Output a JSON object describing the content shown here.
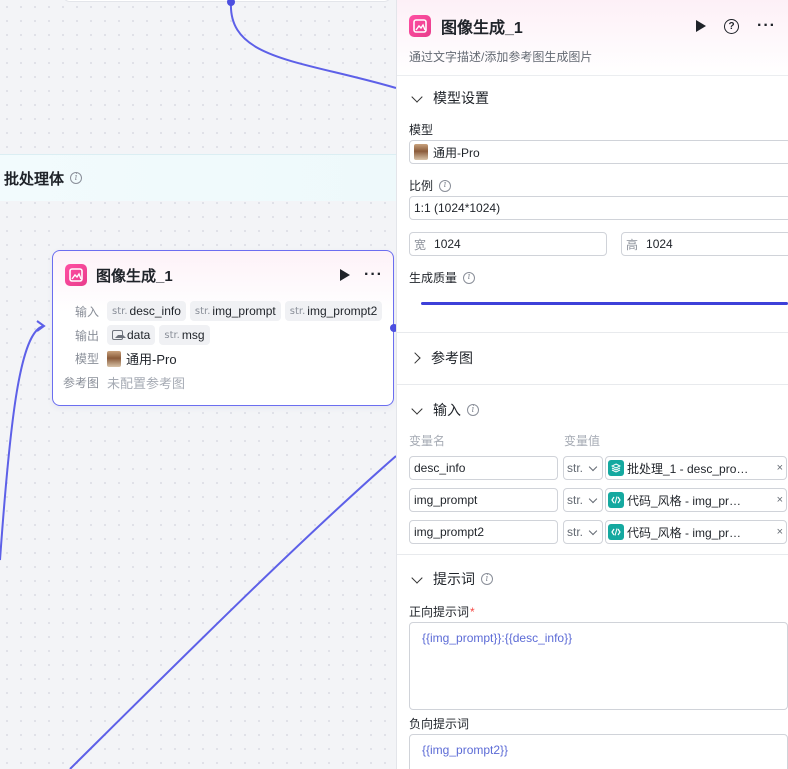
{
  "canvas": {
    "batch_title": "批处理体",
    "node": {
      "title": "图像生成_1",
      "input_label": "输入",
      "output_label": "输出",
      "model_label": "模型",
      "ref_label": "参考图",
      "inputs": [
        {
          "type": "str.",
          "name": "desc_info"
        },
        {
          "type": "str.",
          "name": "img_prompt"
        },
        {
          "type": "str.",
          "name": "img_prompt2"
        }
      ],
      "outputs": [
        {
          "type": "image",
          "name": "data"
        },
        {
          "type": "str.",
          "name": "msg"
        }
      ],
      "model_value": "通用-Pro",
      "ref_value": "未配置参考图"
    }
  },
  "panel": {
    "title": "图像生成_1",
    "description": "通过文字描述/添加参考图生成图片",
    "model_settings": {
      "section_label": "模型设置",
      "model_label": "模型",
      "model_value": "通用-Pro",
      "ratio_label": "比例",
      "ratio_value": "1:1 (1024*1024)",
      "width_label": "宽",
      "width_value": "1024",
      "height_label": "高",
      "height_value": "1024",
      "quality_label": "生成质量"
    },
    "reference": {
      "section_label": "参考图"
    },
    "input": {
      "section_label": "输入",
      "col_name": "变量名",
      "col_value": "变量值",
      "rows": [
        {
          "name": "desc_info",
          "type": "str.",
          "ref_icon": "layers-icon",
          "ref": "批处理_1 - desc_pro…"
        },
        {
          "name": "img_prompt",
          "type": "str.",
          "ref_icon": "code-icon",
          "ref": "代码_风格 - img_pr…"
        },
        {
          "name": "img_prompt2",
          "type": "str.",
          "ref_icon": "code-icon",
          "ref": "代码_风格 - img_pr…"
        }
      ]
    },
    "prompt": {
      "section_label": "提示词",
      "positive_label": "正向提示词",
      "positive_value": "{{img_prompt}}:{{desc_info}}",
      "negative_label": "负向提示词",
      "negative_value": "{{img_prompt2}}"
    }
  },
  "colors": {
    "accent": "#4c4fe0",
    "node_border": "#6b6ef0",
    "app_icon": "#ff4fa3",
    "ref_icon": "#15a9a0",
    "edge": "#5d60e8"
  }
}
